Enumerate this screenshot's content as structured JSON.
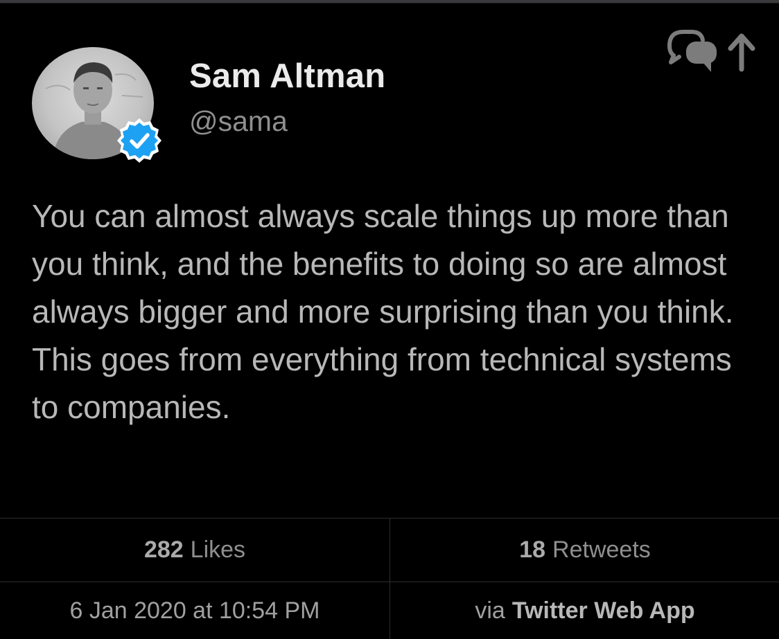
{
  "tweet": {
    "author": {
      "name": "Sam Altman",
      "handle": "@sama",
      "verified": true,
      "avatar_icon": "profile-photo"
    },
    "text": "You can almost always scale things up more than you think, and the benefits to doing so are almost always bigger and more surprising than you think.  This goes from everything from technical systems to companies.",
    "stats": {
      "likes_count": "282",
      "likes_label": "Likes",
      "retweets_count": "18",
      "retweets_label": "Retweets"
    },
    "timestamp": "6 Jan 2020 at 10:54 PM",
    "source": {
      "prefix": "via",
      "app": "Twitter Web App"
    },
    "share_icon": "share-conversation-icon"
  },
  "colors": {
    "background": "#000000",
    "name": "#ebebeb",
    "body_text": "#b8b8b8",
    "secondary": "#8f8f8f",
    "divider": "#2e2e30",
    "verified_blue": "#1da1f2"
  }
}
